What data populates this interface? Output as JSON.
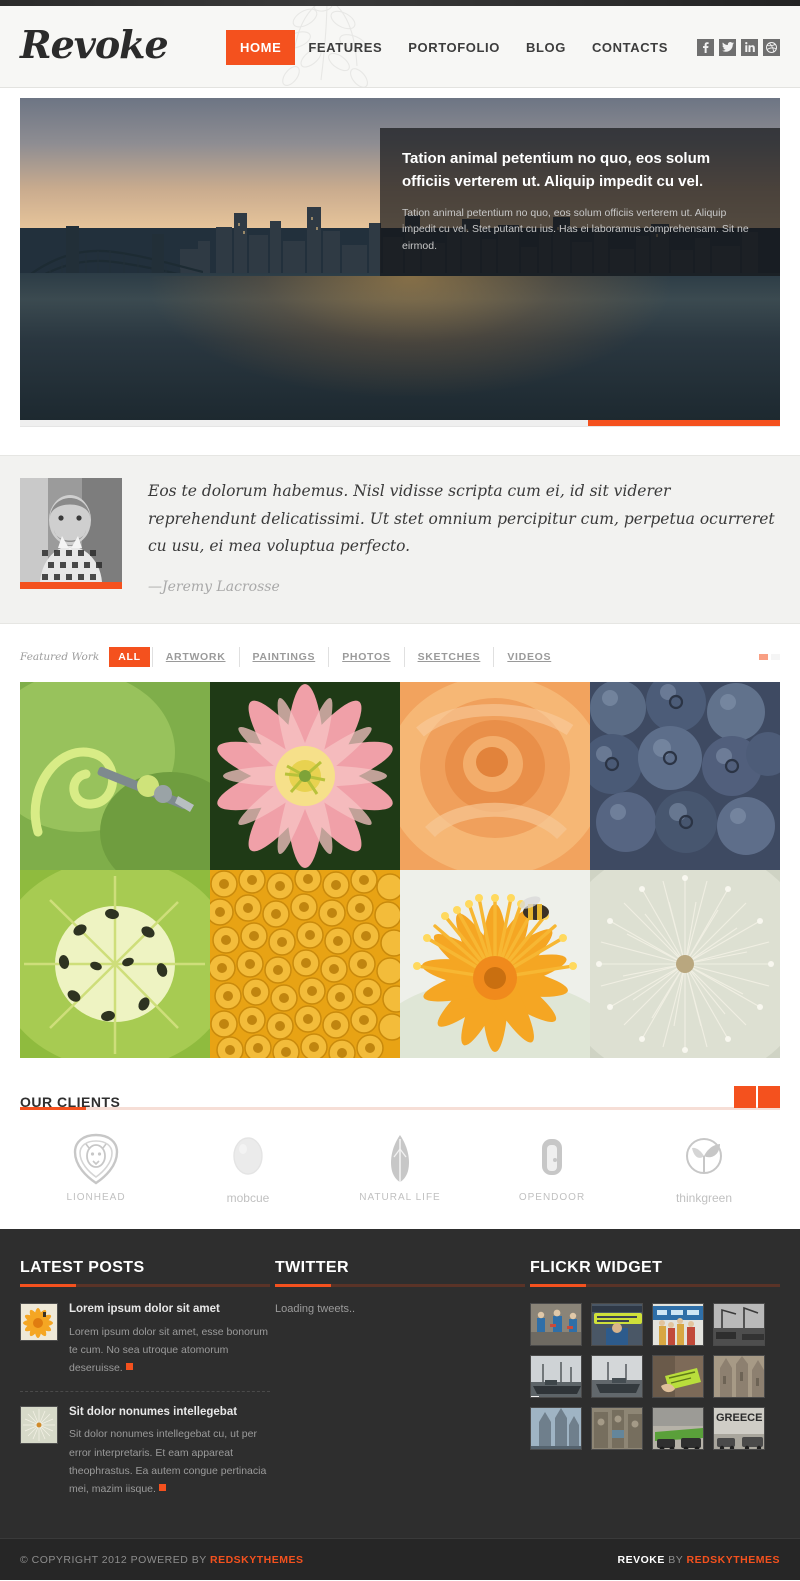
{
  "colors": {
    "accent": "#f4511e",
    "footer_bg": "#2e2e2e",
    "bottom_bg": "#262626",
    "testimonial_bg": "#f2f2f0",
    "header_bg": "#f7f7f5"
  },
  "header": {
    "logo": "Revoke",
    "nav": [
      {
        "label": "HOME",
        "active": true
      },
      {
        "label": "FEATURES",
        "active": false
      },
      {
        "label": "PORTOFOLIO",
        "active": false
      },
      {
        "label": "BLOG",
        "active": false
      },
      {
        "label": "CONTACTS",
        "active": false
      }
    ],
    "social": [
      {
        "name": "facebook-icon",
        "glyph": "f"
      },
      {
        "name": "twitter-icon",
        "glyph": "ᵗ"
      },
      {
        "name": "linkedin-icon",
        "glyph": "in"
      },
      {
        "name": "dribbble-icon",
        "glyph": "◎"
      }
    ]
  },
  "slider": {
    "caption_title": "Tation animal petentium no quo, eos solum officiis verterem ut. Aliquip impedit cu vel.",
    "caption_text": "Tation animal petentium no quo, eos solum officiis verterem ut. Aliquip impedit cu vel. Stet putant cu ius. Has ei laboramus comprehensam. Sit ne eirmod.",
    "progress_percent": 25
  },
  "testimonial": {
    "quote": "Eos te dolorum habemus. Nisl vidisse scripta cum ei, id sit viderer reprehendunt delicatissimi. Ut stet omnium percipitur cum, perpetua ocurreret cu usu, ei mea voluptua perfecto.",
    "author": "—Jeremy Lacrosse"
  },
  "portfolio": {
    "featured_label": "Featured Work",
    "filters": [
      {
        "label": "ALL",
        "active": true
      },
      {
        "label": "ARTWORK",
        "active": false
      },
      {
        "label": "PAINTINGS",
        "active": false
      },
      {
        "label": "PHOTOS",
        "active": false
      },
      {
        "label": "SKETCHES",
        "active": false
      },
      {
        "label": "VIDEOS",
        "active": false
      }
    ],
    "items": [
      {
        "name": "green-tendril-vine"
      },
      {
        "name": "pink-tulip-flower"
      },
      {
        "name": "orange-rose-macro"
      },
      {
        "name": "blueberries-cluster"
      },
      {
        "name": "kiwi-fruit-slice"
      },
      {
        "name": "yellow-pasta-tubes"
      },
      {
        "name": "orange-flower-with-bee"
      },
      {
        "name": "dandelion-seedhead"
      }
    ]
  },
  "clients": {
    "title": "OUR CLIENTS",
    "logos": [
      {
        "name": "LIONHEAD",
        "style": "upper"
      },
      {
        "name": "mobcue",
        "style": "lower"
      },
      {
        "name": "NATURAL LIFE",
        "style": "upper"
      },
      {
        "name": "OPENDOOR",
        "style": "upper"
      },
      {
        "name": "thinkgreen",
        "style": "lower"
      }
    ]
  },
  "footer": {
    "latest_posts": {
      "title": "LATEST POSTS",
      "posts": [
        {
          "title": "Lorem ipsum dolor sit amet",
          "text": "Lorem ipsum dolor sit amet, esse bonorum te cum. No sea utroque atomorum deseruisse.",
          "thumb": "orange-dandelion-thumb"
        },
        {
          "title": "Sit dolor nonumes intellegebat",
          "text": "Sit dolor nonumes intellegebat cu, ut per error interpretaris. Et eam appareat theophrastus. Ea autem congue pertinacia mei, mazim iisque.",
          "thumb": "dandelion-seed-thumb"
        }
      ]
    },
    "twitter": {
      "title": "TWITTER",
      "status": "Loading tweets.."
    },
    "flickr": {
      "title": "FLICKR WIDGET",
      "photos": [
        {
          "name": "marathon-runners"
        },
        {
          "name": "protest-banner-yellow"
        },
        {
          "name": "crowd-blue-banner"
        },
        {
          "name": "bw-harbour-cranes"
        },
        {
          "name": "boats-harbour-1"
        },
        {
          "name": "boats-harbour-2"
        },
        {
          "name": "green-flyer-hand"
        },
        {
          "name": "sagrada-familia-facade"
        },
        {
          "name": "cathedral-spires"
        },
        {
          "name": "stone-sculpture-wall"
        },
        {
          "name": "street-graffiti-cars"
        },
        {
          "name": "greece-graffiti-wall"
        }
      ]
    }
  },
  "bottom": {
    "copyright_pre": "© COPYRIGHT 2012 POWERED BY ",
    "copyright_brand": "REDSKYTHEMES",
    "credit_brand": "REVOKE",
    "credit_by": " BY ",
    "credit_author": "REDSKYTHEMES"
  }
}
